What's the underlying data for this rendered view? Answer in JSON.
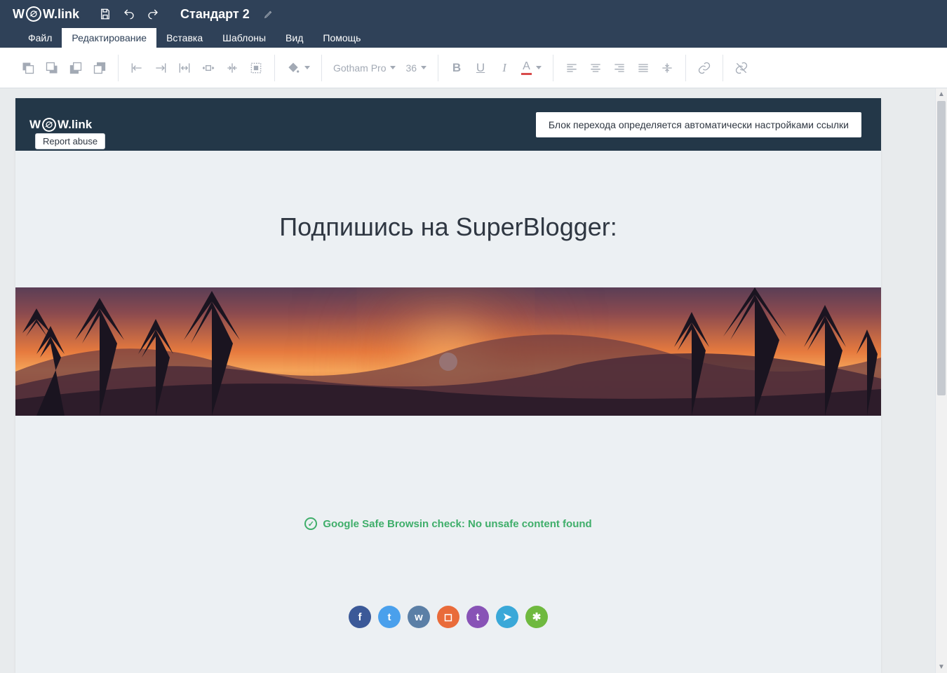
{
  "app": {
    "logo_text_left": "W",
    "logo_text_right": "W.link",
    "doc_title": "Стандарт 2"
  },
  "menu": {
    "items": [
      "Файл",
      "Редактирование",
      "Вставка",
      "Шаблоны",
      "Вид",
      "Помощь"
    ],
    "active_index": 1
  },
  "toolbar": {
    "font": "Gotham Pro",
    "size": "36"
  },
  "page": {
    "logo_left": "W",
    "logo_right": "W.link",
    "report_abuse": "Report abuse",
    "transition_notice": "Блок перехода определяется автоматически настройками ссылки",
    "headline": "Подпишись на SuperBlogger:",
    "safe_browsing": "Google Safe Browsin check: No unsafe content found",
    "safe_check": "✓"
  },
  "socials": [
    {
      "name": "facebook",
      "glyph": "f",
      "color": "#3b5998"
    },
    {
      "name": "twitter",
      "glyph": "t",
      "color": "#4aa0ec"
    },
    {
      "name": "vk",
      "glyph": "w",
      "color": "#5b7fa6"
    },
    {
      "name": "instagram",
      "glyph": "◻",
      "color": "#e96b3a"
    },
    {
      "name": "tumblr",
      "glyph": "t",
      "color": "#8853b6"
    },
    {
      "name": "telegram",
      "glyph": "➤",
      "color": "#3aa8d8"
    },
    {
      "name": "evernote",
      "glyph": "✱",
      "color": "#6fb93f"
    }
  ]
}
